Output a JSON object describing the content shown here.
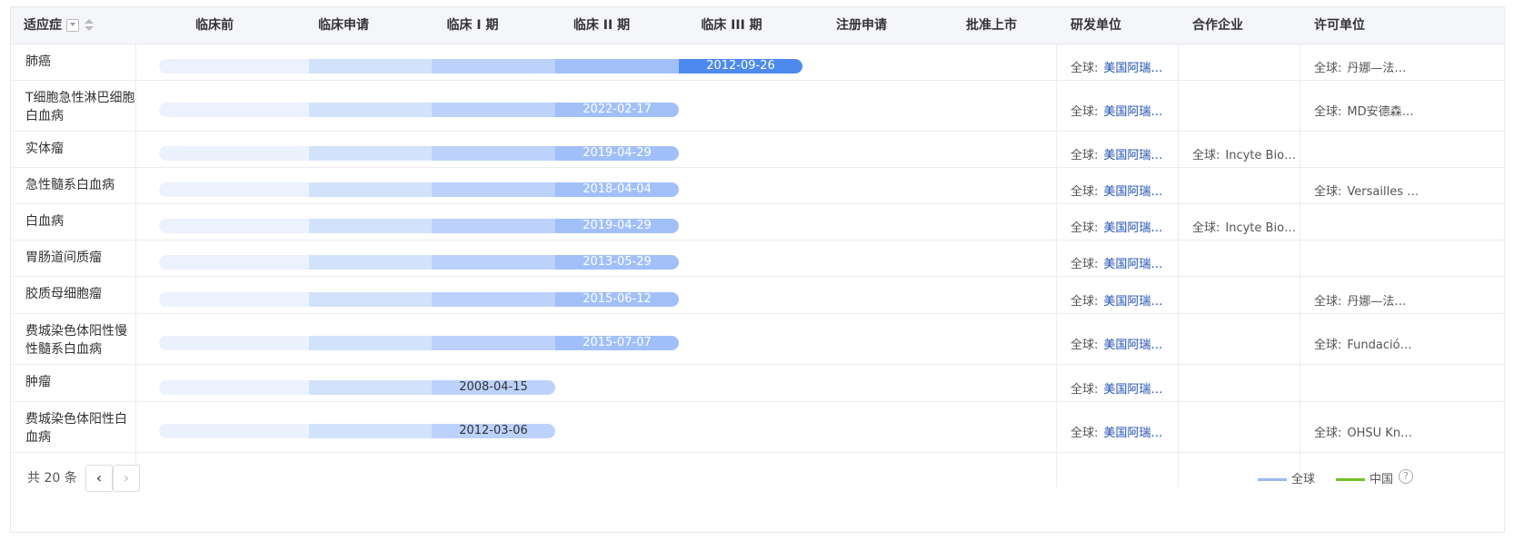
{
  "header": {
    "indication": "适应症",
    "stages": [
      "临床前",
      "临床申请",
      "临床 I 期",
      "临床 II 期",
      "临床 III 期",
      "注册申请",
      "批准上市"
    ],
    "developer": "研发单位",
    "partner": "合作企业",
    "licensor": "许可单位"
  },
  "rows": [
    {
      "indication": "肺癌",
      "stage_reached": 5,
      "date": "2012-09-26",
      "dev_prefix": "全球:",
      "dev": "美国阿瑞…",
      "partner_prefix": "",
      "partner": "",
      "lic_prefix": "全球:",
      "lic": "丹娜—法…"
    },
    {
      "indication": "T细胞急性淋巴细胞白血病",
      "stage_reached": 4,
      "date": "2022-02-17",
      "dev_prefix": "全球:",
      "dev": "美国阿瑞…",
      "partner_prefix": "",
      "partner": "",
      "lic_prefix": "全球:",
      "lic": "MD安德森…"
    },
    {
      "indication": "实体瘤",
      "stage_reached": 4,
      "date": "2019-04-29",
      "dev_prefix": "全球:",
      "dev": "美国阿瑞…",
      "partner_prefix": "全球:",
      "partner": "Incyte Bio…",
      "lic_prefix": "",
      "lic": ""
    },
    {
      "indication": "急性髓系白血病",
      "stage_reached": 4,
      "date": "2018-04-04",
      "dev_prefix": "全球:",
      "dev": "美国阿瑞…",
      "partner_prefix": "",
      "partner": "",
      "lic_prefix": "全球:",
      "lic": "Versailles …"
    },
    {
      "indication": "白血病",
      "stage_reached": 4,
      "date": "2019-04-29",
      "dev_prefix": "全球:",
      "dev": "美国阿瑞…",
      "partner_prefix": "全球:",
      "partner": "Incyte Bio…",
      "lic_prefix": "",
      "lic": ""
    },
    {
      "indication": "胃肠道间质瘤",
      "stage_reached": 4,
      "date": "2013-05-29",
      "dev_prefix": "全球:",
      "dev": "美国阿瑞…",
      "partner_prefix": "",
      "partner": "",
      "lic_prefix": "",
      "lic": ""
    },
    {
      "indication": "胶质母细胞瘤",
      "stage_reached": 4,
      "date": "2015-06-12",
      "dev_prefix": "全球:",
      "dev": "美国阿瑞…",
      "partner_prefix": "",
      "partner": "",
      "lic_prefix": "全球:",
      "lic": "丹娜—法…"
    },
    {
      "indication": "费城染色体阳性慢性髓系白血病",
      "stage_reached": 4,
      "date": "2015-07-07",
      "dev_prefix": "全球:",
      "dev": "美国阿瑞…",
      "partner_prefix": "",
      "partner": "",
      "lic_prefix": "全球:",
      "lic": "Fundació…"
    },
    {
      "indication": "肿瘤",
      "stage_reached": 3,
      "date": "2008-04-15",
      "dev_prefix": "全球:",
      "dev": "美国阿瑞…",
      "partner_prefix": "",
      "partner": "",
      "lic_prefix": "",
      "lic": ""
    },
    {
      "indication": "费城染色体阳性白血病",
      "stage_reached": 3,
      "date": "2012-03-06",
      "dev_prefix": "全球:",
      "dev": "美国阿瑞…",
      "partner_prefix": "",
      "partner": "",
      "lic_prefix": "全球:",
      "lic": "OHSU Kn…"
    }
  ],
  "footer": {
    "total": "共 20 条",
    "prev": "‹",
    "next": "›",
    "legend": [
      {
        "label": "全球",
        "color": "#9db8f2"
      },
      {
        "label": "中国",
        "color": "#73c12a"
      }
    ],
    "help": "?"
  },
  "icons": {
    "filter": "filter-dropdown-icon",
    "sort": "sort-arrows-icon",
    "help": "help-circle-icon"
  }
}
